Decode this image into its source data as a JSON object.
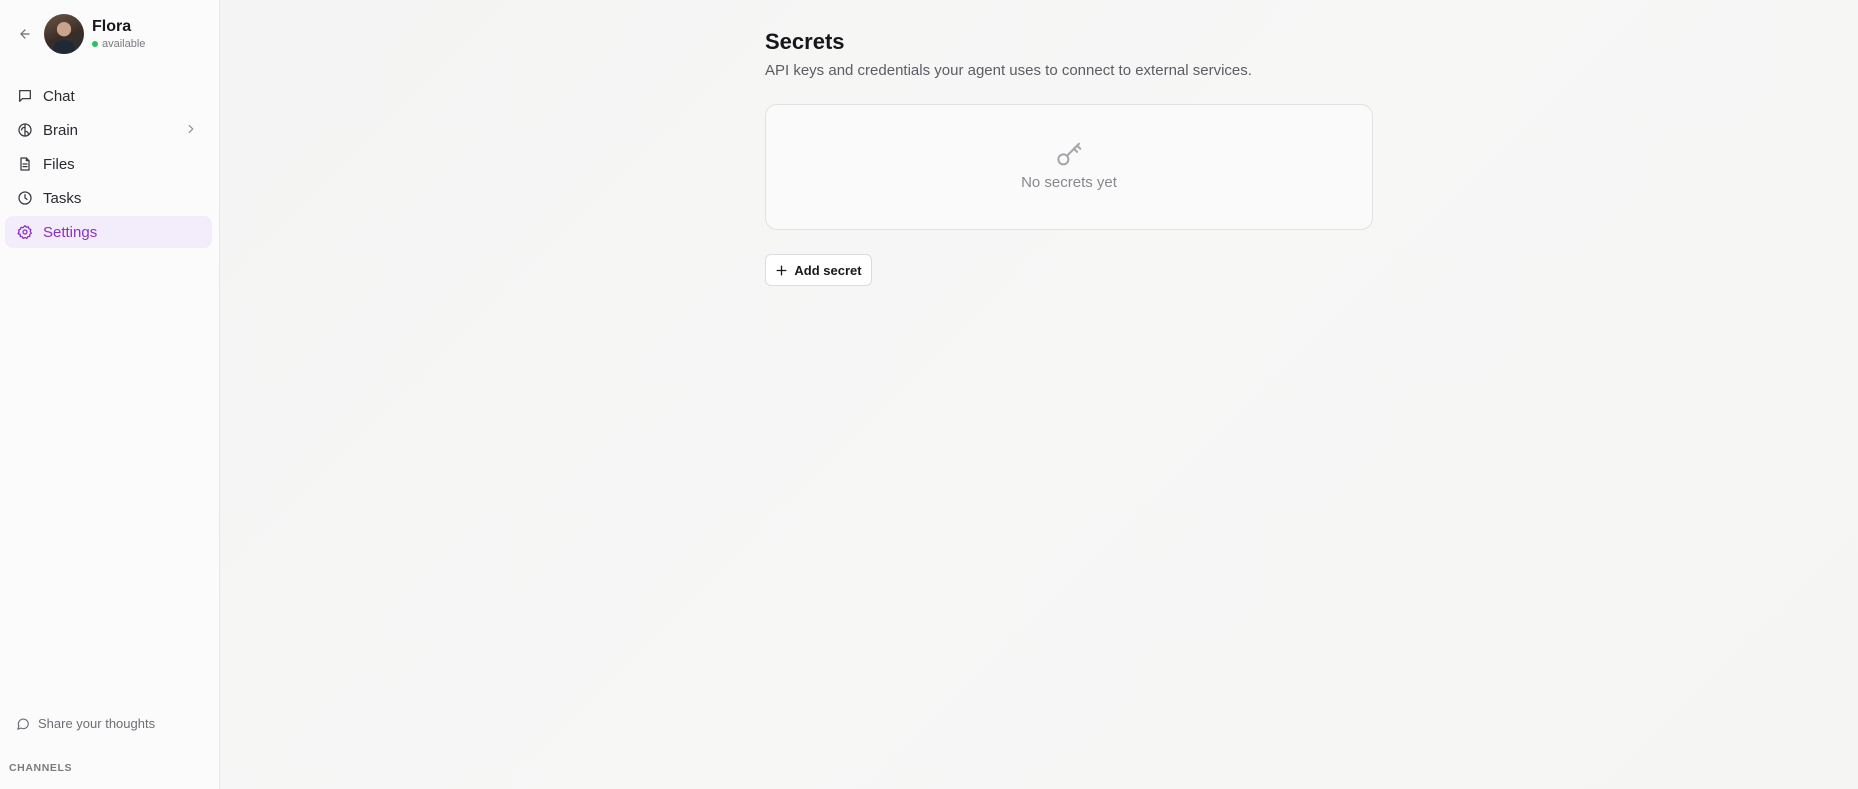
{
  "profile": {
    "name": "Flora",
    "status": "available",
    "status_color": "#22c55e"
  },
  "nav": {
    "items": [
      {
        "label": "Chat",
        "icon": "chat-bubble-icon"
      },
      {
        "label": "Brain",
        "icon": "brain-icon",
        "has_submenu": true
      },
      {
        "label": "Files",
        "icon": "file-icon"
      },
      {
        "label": "Tasks",
        "icon": "clock-icon"
      },
      {
        "label": "Settings",
        "icon": "gear-icon",
        "active": true
      }
    ]
  },
  "feedback": {
    "label": "Share your thoughts",
    "icon": "message-circle-icon"
  },
  "channels": {
    "label": "CHANNELS"
  },
  "page": {
    "title": "Secrets",
    "subtitle": "API keys and credentials your agent uses to connect to external services."
  },
  "empty_state": {
    "icon": "key-icon",
    "text": "No secrets yet"
  },
  "add_button": {
    "label": "Add secret",
    "icon": "plus-icon"
  },
  "colors": {
    "accent": "#8b2fc9",
    "active_bg": "#f3ecfb",
    "text_primary": "#15151a",
    "text_muted": "#88888e"
  }
}
